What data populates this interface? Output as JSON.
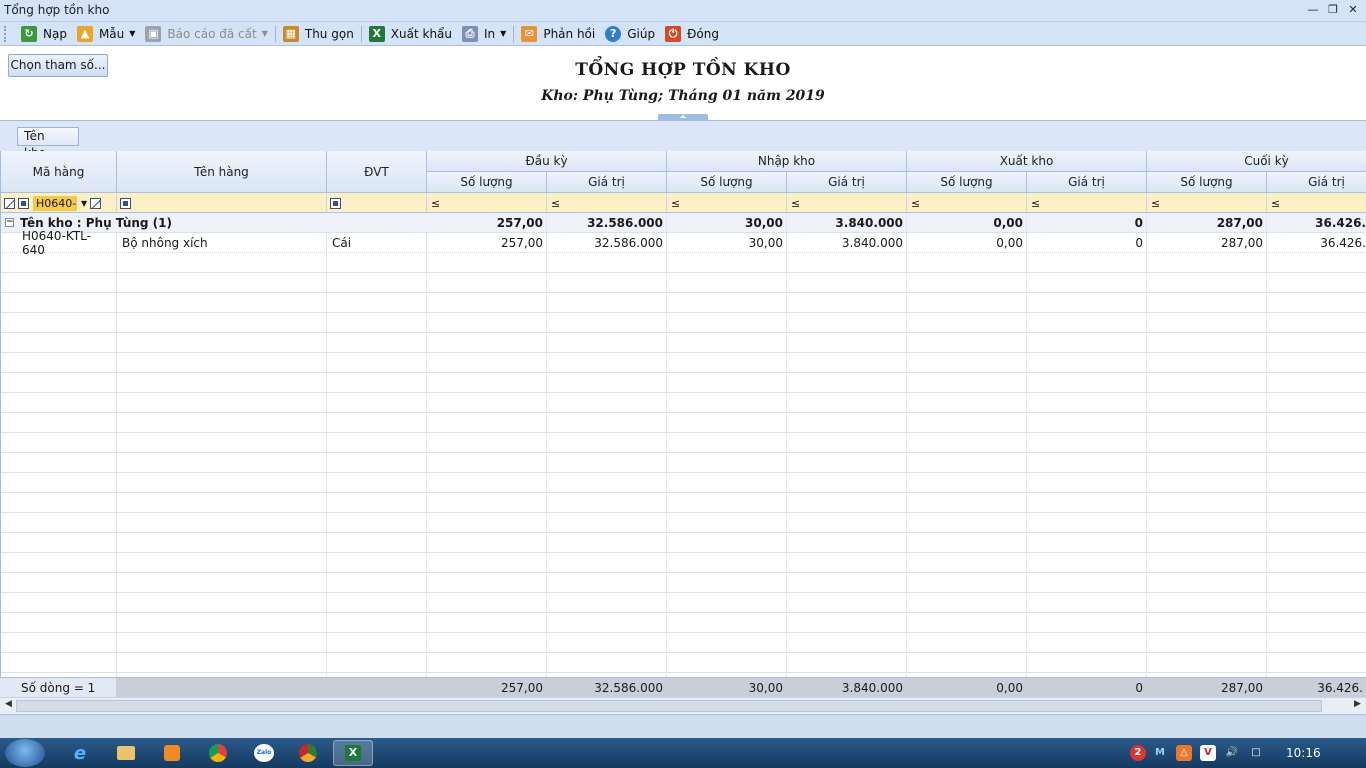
{
  "window": {
    "title": "Tổng hợp tồn kho"
  },
  "toolbar": {
    "reload": "Nạp",
    "template": "Mẫu",
    "saved_reports": "Báo cáo đã cất",
    "collapse": "Thu gọn",
    "export": "Xuất khẩu",
    "print": "In",
    "feedback": "Phản hồi",
    "help": "Giúp",
    "close": "Đóng"
  },
  "params_button": "Chọn tham số...",
  "report": {
    "title": "TỔNG HỢP TỒN KHO",
    "subtitle": "Kho: Phụ Tùng; Tháng 01 năm 2019"
  },
  "group_panel": {
    "chip": "Tên kho"
  },
  "grid": {
    "headers": {
      "ma_hang": "Mã hàng",
      "ten_hang": "Tên hàng",
      "dvt": "ĐVT",
      "dau_ky": "Đầu kỳ",
      "nhap_kho": "Nhập kho",
      "xuat_kho": "Xuất kho",
      "cuoi_ky": "Cuối kỳ",
      "so_luong": "Số lượng",
      "gia_tri": "Giá trị"
    },
    "filter": {
      "ma_hang_value": "H0640-",
      "op": "≤"
    },
    "group_row": {
      "label": "Tên kho : Phụ Tùng (1)",
      "dau_ky_sl": "257,00",
      "dau_ky_gt": "32.586.000",
      "nhap_sl": "30,00",
      "nhap_gt": "3.840.000",
      "xuat_sl": "0,00",
      "xuat_gt": "0",
      "cuoi_sl": "287,00",
      "cuoi_gt": "36.426."
    },
    "rows": [
      {
        "ma_hang": "H0640-KTL-640",
        "ten_hang": "Bộ nhông xích",
        "dvt": "Cái",
        "dau_ky_sl": "257,00",
        "dau_ky_gt": "32.586.000",
        "nhap_sl": "30,00",
        "nhap_gt": "3.840.000",
        "xuat_sl": "0,00",
        "xuat_gt": "0",
        "cuoi_sl": "287,00",
        "cuoi_gt": "36.426."
      }
    ],
    "footer": {
      "row_count": "Số dòng = 1",
      "dau_ky_sl": "257,00",
      "dau_ky_gt": "32.586.000",
      "nhap_sl": "30,00",
      "nhap_gt": "3.840.000",
      "xuat_sl": "0,00",
      "xuat_gt": "0",
      "cuoi_sl": "287,00",
      "cuoi_gt": "36.426."
    }
  },
  "taskbar": {
    "clock": "10:16",
    "apps": [
      "ie-icon",
      "explorer-icon",
      "media-player-icon",
      "chrome-icon",
      "zalo-icon",
      "coccoc-icon",
      "excel-icon"
    ],
    "zalo_label": "Zalo",
    "notification_count": "2"
  },
  "colors": {
    "toolbar_bg": "#d4e3f6",
    "filter_bg": "#fcf0c7",
    "taskbar_bg": "#1d4a75"
  }
}
